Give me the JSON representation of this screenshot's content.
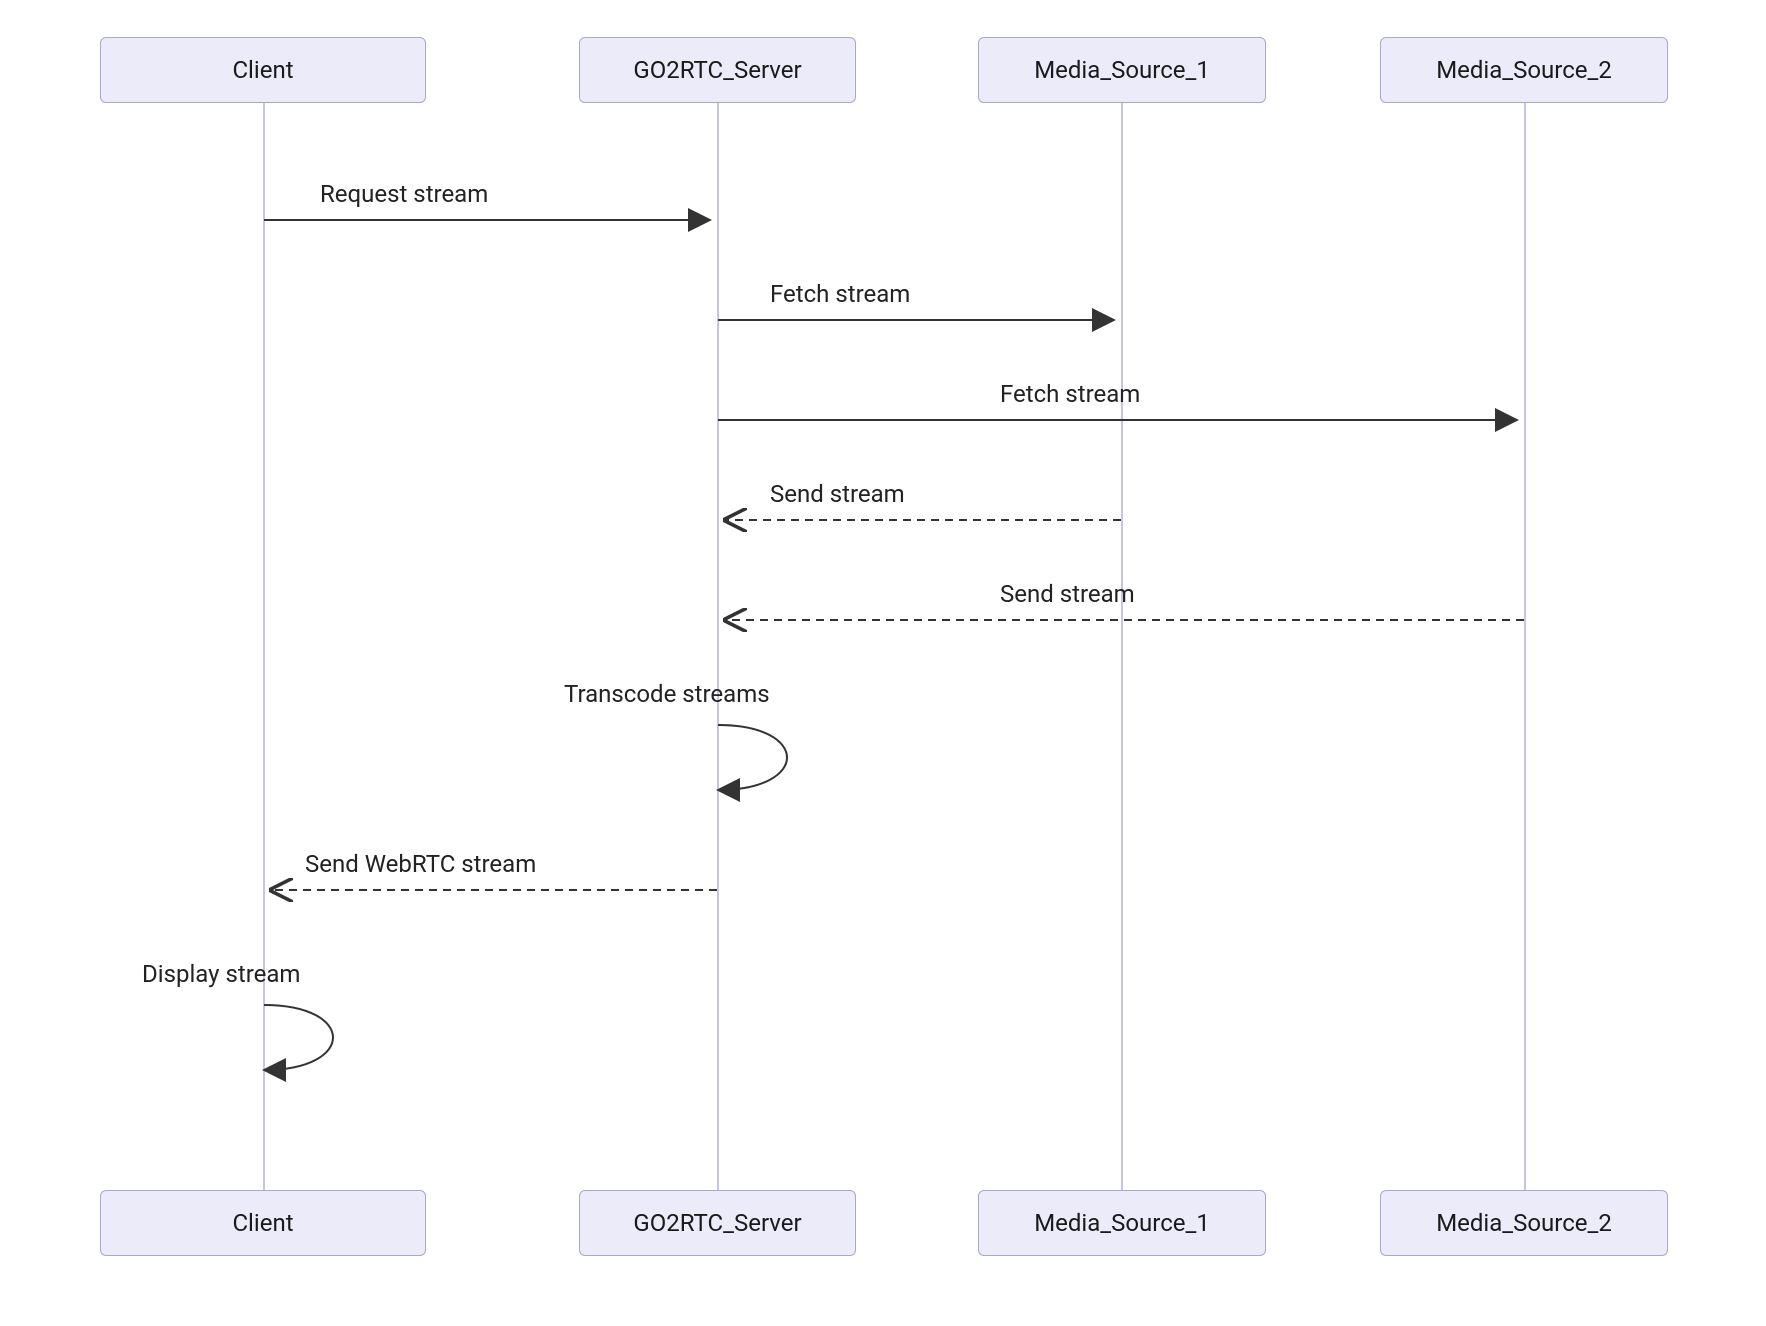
{
  "actors": [
    {
      "id": "client",
      "label": "Client"
    },
    {
      "id": "server",
      "label": "GO2RTC_Server"
    },
    {
      "id": "ms1",
      "label": "Media_Source_1"
    },
    {
      "id": "ms2",
      "label": "Media_Source_2"
    }
  ],
  "messages": [
    {
      "id": "m1",
      "label": "Request stream"
    },
    {
      "id": "m2",
      "label": "Fetch stream"
    },
    {
      "id": "m3",
      "label": "Fetch stream"
    },
    {
      "id": "m4",
      "label": "Send stream"
    },
    {
      "id": "m5",
      "label": "Send stream"
    },
    {
      "id": "m6",
      "label": "Transcode streams"
    },
    {
      "id": "m7",
      "label": "Send WebRTC stream"
    },
    {
      "id": "m8",
      "label": "Display stream"
    }
  ],
  "chart_data": {
    "type": "sequence_diagram",
    "participants": [
      "Client",
      "GO2RTC_Server",
      "Media_Source_1",
      "Media_Source_2"
    ],
    "interactions": [
      {
        "from": "Client",
        "to": "GO2RTC_Server",
        "label": "Request stream",
        "style": "solid"
      },
      {
        "from": "GO2RTC_Server",
        "to": "Media_Source_1",
        "label": "Fetch stream",
        "style": "solid"
      },
      {
        "from": "GO2RTC_Server",
        "to": "Media_Source_2",
        "label": "Fetch stream",
        "style": "solid"
      },
      {
        "from": "Media_Source_1",
        "to": "GO2RTC_Server",
        "label": "Send stream",
        "style": "dashed"
      },
      {
        "from": "Media_Source_2",
        "to": "GO2RTC_Server",
        "label": "Send stream",
        "style": "dashed"
      },
      {
        "from": "GO2RTC_Server",
        "to": "GO2RTC_Server",
        "label": "Transcode streams",
        "style": "self"
      },
      {
        "from": "GO2RTC_Server",
        "to": "Client",
        "label": "Send WebRTC stream",
        "style": "dashed"
      },
      {
        "from": "Client",
        "to": "Client",
        "label": "Display stream",
        "style": "self"
      }
    ]
  }
}
